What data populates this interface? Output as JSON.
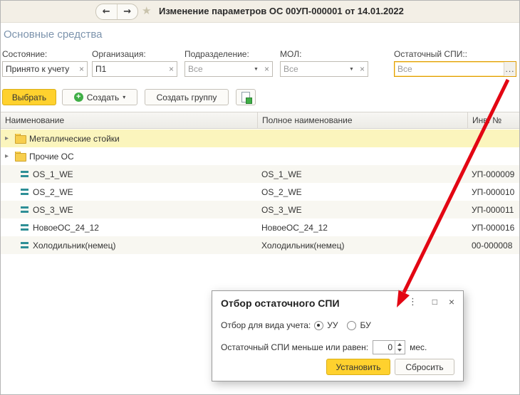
{
  "header": {
    "title": "Изменение параметров ОС 00УП-000001 от 14.01.2022"
  },
  "section_title": "Основные средства",
  "icons": {
    "back": "←",
    "forward": "→",
    "favorite_star": "★",
    "create_plus": "+",
    "dropdown_caret": "▾",
    "clear": "×",
    "select_arrow": "▼",
    "ellipsis": "...",
    "expand_triangle": "▸",
    "menu_dots": "⋮",
    "maximize": "□",
    "close": "×"
  },
  "filters": [
    {
      "label": "Состояние:",
      "value": "Принято к учету"
    },
    {
      "label": "Организация:",
      "value": "П1"
    },
    {
      "label": "Подразделение:",
      "value": "Все"
    },
    {
      "label": "МОЛ:",
      "value": "Все"
    },
    {
      "label": "Остаточный СПИ::",
      "value": "Все"
    }
  ],
  "toolbar": {
    "select": "Выбрать",
    "create": "Создать",
    "create_group": "Создать группу"
  },
  "table": {
    "columns": [
      "Наименование",
      "Полное наименование",
      "Инв. №"
    ],
    "rows": [
      {
        "type": "folder",
        "selected": true,
        "name": "Металлические стойки",
        "full_name": "",
        "inv": ""
      },
      {
        "type": "folder",
        "selected": false,
        "name": "Прочие ОС",
        "full_name": "",
        "inv": ""
      },
      {
        "type": "item",
        "selected": false,
        "name": "OS_1_WE",
        "full_name": "OS_1_WE",
        "inv": "УП-000009"
      },
      {
        "type": "item",
        "selected": false,
        "name": "OS_2_WE",
        "full_name": "OS_2_WE",
        "inv": "УП-000010"
      },
      {
        "type": "item",
        "selected": false,
        "name": "OS_3_WE",
        "full_name": "OS_3_WE",
        "inv": "УП-000011"
      },
      {
        "type": "item",
        "selected": false,
        "name": "НовоеОС_24_12",
        "full_name": "НовоеОС_24_12",
        "inv": "УП-000016"
      },
      {
        "type": "item",
        "selected": false,
        "name": "Холодильник(немец)",
        "full_name": "Холодильник(немец)",
        "inv": "00-000008"
      }
    ]
  },
  "dialog": {
    "title": "Отбор остаточного СПИ",
    "account_label": "Отбор для вида учета:",
    "radio_uu": "УУ",
    "radio_bu": "БУ",
    "radio_selected": "УУ",
    "spi_label": "Остаточный СПИ меньше или равен:",
    "spi_value": "0",
    "spi_unit": "мес.",
    "set_button": "Установить",
    "reset_button": "Сбросить"
  },
  "colors": {
    "accent_yellow": "#ffd12e",
    "field_highlight": "#df9c00",
    "selected_row": "#fbf5bd",
    "arrow_red": "#e30613",
    "folder_yellow": "#f7ce4e",
    "section_title_blue": "#7d94ad"
  }
}
